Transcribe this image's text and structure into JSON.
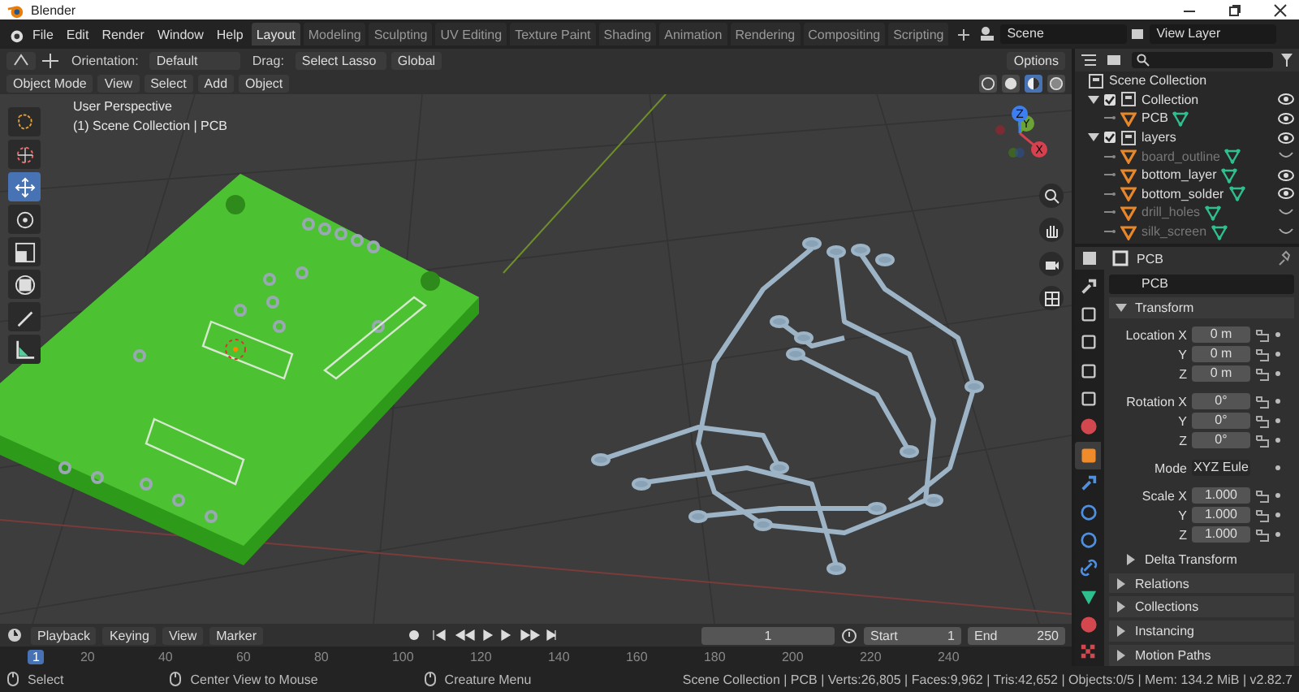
{
  "window": {
    "title": "Blender"
  },
  "menu": [
    "File",
    "Edit",
    "Render",
    "Window",
    "Help"
  ],
  "workspaces": [
    {
      "label": "Layout",
      "selected": true
    },
    {
      "label": "Modeling",
      "selected": false
    },
    {
      "label": "Sculpting",
      "selected": false
    },
    {
      "label": "UV Editing",
      "selected": false
    },
    {
      "label": "Texture Paint",
      "selected": false
    },
    {
      "label": "Shading",
      "selected": false
    },
    {
      "label": "Animation",
      "selected": false
    },
    {
      "label": "Rendering",
      "selected": false
    },
    {
      "label": "Compositing",
      "selected": false
    },
    {
      "label": "Scripting",
      "selected": false
    }
  ],
  "scene": "Scene",
  "view_layer": "View Layer",
  "tool_settings": {
    "orientation_label": "Orientation:",
    "orientation": "Default",
    "drag_label": "Drag:",
    "drag": "Select Lasso",
    "transform": "Global",
    "options": "Options"
  },
  "viewport_header": {
    "mode": "Object Mode",
    "menus": [
      "View",
      "Select",
      "Add",
      "Object"
    ],
    "shading": [
      {
        "kind": "wireframe",
        "selected": false
      },
      {
        "kind": "solid",
        "selected": false
      },
      {
        "kind": "material",
        "selected": true
      },
      {
        "kind": "rendered",
        "selected": false
      }
    ]
  },
  "viewport": {
    "view_name": "User Perspective",
    "collection_info": "(1) Scene Collection | PCB",
    "gizmo_axes": [
      {
        "label": "X",
        "color": "#d6404f"
      },
      {
        "label": "Y",
        "color": "#6ba336"
      },
      {
        "label": "Z",
        "color": "#3d7ff0"
      }
    ]
  },
  "toolbar": [
    {
      "kind": "select",
      "selected": false
    },
    {
      "kind": "cursor",
      "selected": false
    },
    {
      "kind": "move",
      "selected": true
    },
    {
      "kind": "rotate",
      "selected": false
    },
    {
      "kind": "scale",
      "selected": false
    },
    {
      "kind": "transform",
      "selected": false
    },
    {
      "kind": "annotate",
      "selected": false
    },
    {
      "kind": "measure",
      "selected": false
    }
  ],
  "outliner": {
    "root": "Scene Collection",
    "items": [
      {
        "label": "Collection",
        "kind": "collection",
        "checked": true,
        "visible": true,
        "children": [
          {
            "label": "PCB",
            "kind": "mesh",
            "visible": true
          }
        ]
      },
      {
        "label": "layers",
        "kind": "collection",
        "checked": true,
        "visible": true,
        "children": [
          {
            "label": "board_outline",
            "kind": "mesh",
            "visible": false
          },
          {
            "label": "bottom_layer",
            "kind": "mesh",
            "visible": true
          },
          {
            "label": "bottom_solder",
            "kind": "mesh",
            "visible": true
          },
          {
            "label": "drill_holes",
            "kind": "mesh",
            "visible": false
          },
          {
            "label": "silk_screen",
            "kind": "mesh",
            "visible": false
          }
        ]
      }
    ]
  },
  "properties": {
    "object_name": "PCB",
    "data_name": "PCB",
    "tabs": [
      {
        "kind": "tool",
        "selected": false
      },
      {
        "kind": "render",
        "selected": false
      },
      {
        "kind": "output",
        "selected": false
      },
      {
        "kind": "view_layer",
        "selected": false
      },
      {
        "kind": "scene",
        "selected": false
      },
      {
        "kind": "world",
        "selected": false
      },
      {
        "kind": "object",
        "selected": true
      },
      {
        "kind": "modifier",
        "selected": false
      },
      {
        "kind": "particles",
        "selected": false
      },
      {
        "kind": "physics",
        "selected": false
      },
      {
        "kind": "constraints",
        "selected": false
      },
      {
        "kind": "data",
        "selected": false
      },
      {
        "kind": "material",
        "selected": false
      },
      {
        "kind": "texture",
        "selected": false
      }
    ],
    "transform": {
      "title": "Transform",
      "expanded": true,
      "groups": [
        [
          {
            "label": "Location X",
            "value": "0 m"
          },
          {
            "label": "Y",
            "value": "0 m"
          },
          {
            "label": "Z",
            "value": "0 m"
          }
        ],
        [
          {
            "label": "Rotation X",
            "value": "0°"
          },
          {
            "label": "Y",
            "value": "0°"
          },
          {
            "label": "Z",
            "value": "0°"
          }
        ]
      ],
      "mode_label": "Mode",
      "mode": "XYZ Eule",
      "scale": [
        {
          "label": "Scale X",
          "value": "1.000"
        },
        {
          "label": "Y",
          "value": "1.000"
        },
        {
          "label": "Z",
          "value": "1.000"
        }
      ],
      "subpanel": {
        "label": "Delta Transform",
        "expanded": false
      }
    },
    "panels": [
      {
        "label": "Relations",
        "expanded": false
      },
      {
        "label": "Collections",
        "expanded": false
      },
      {
        "label": "Instancing",
        "expanded": false
      },
      {
        "label": "Motion Paths",
        "expanded": false
      }
    ]
  },
  "timeline": {
    "menus": [
      "Playback",
      "Keying",
      "View",
      "Marker"
    ],
    "current_frame": "1",
    "start_label": "Start",
    "start": "1",
    "end_label": "End",
    "end": "250",
    "playhead": "1",
    "ticks": [
      "20",
      "40",
      "60",
      "80",
      "100",
      "120",
      "140",
      "160",
      "180",
      "200",
      "220",
      "240"
    ]
  },
  "status_bar": {
    "hints": [
      "Select",
      "Center View to Mouse",
      "Creature Menu"
    ],
    "stats": "Scene Collection | PCB | Verts:26,805 | Faces:9,962 | Tris:42,652 | Objects:0/5 | Mem: 134.2 MiB | v2.82.7"
  }
}
